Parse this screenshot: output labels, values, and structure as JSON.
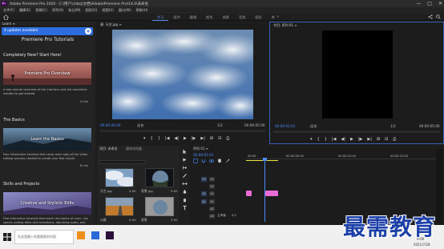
{
  "window": {
    "app_icon": "Pr",
    "title": "Adobe Premiere Pro 2020 - C:\\用户\\chbsj\\文档\\Adobe\\Premiere Pro\\14.0\\未命名",
    "controls": [
      "—",
      "□",
      "✕"
    ]
  },
  "menu": [
    "文件(F)",
    "编辑(E)",
    "剪辑(C)",
    "序列(S)",
    "标记(M)",
    "图形(G)",
    "视图(V)",
    "窗口(W)",
    "帮助(H)"
  ],
  "workspaces": {
    "tabs": [
      "学习",
      "组件",
      "编辑",
      "颜色",
      "效果",
      "音频",
      "图形",
      "库"
    ],
    "active_index": 0,
    "more": "»"
  },
  "learn": {
    "tab": "Learn ≡",
    "updates_banner": "4 updates available",
    "heading": "Premiere Pro Tutorials",
    "sections": [
      {
        "title": "Completely New? Start Here!",
        "card_title": "Premiere Pro Overview",
        "desc": "A two-minute overview of the interface and the essentials needed to get started.",
        "duration": "2 min"
      },
      {
        "title": "The Basics",
        "card_title": "Learn the Basics",
        "desc": "Four interactive tutorials that cover each step of the video editing process needed to create your first movie.",
        "duration": "8 min"
      },
      {
        "title": "Skills and Projects",
        "card_title": "Creative and Stylistic Edits",
        "desc": "Five interactive tutorials that teach the basics of color, clip speed, adding titles and transitions, adjusting audio, and color correction."
      }
    ]
  },
  "source_monitor": {
    "tab": "源: 天空.jpg ≡",
    "timecode_in": "00:00:00:00",
    "fit": "适合",
    "scale": "1/2",
    "timecode_dur": "00:00:05:00"
  },
  "program_monitor": {
    "tab": "节目: 序列 01 ≡",
    "timecode_in": "00:00:01:01",
    "fit": "适合",
    "scale": "1/2",
    "timecode_dur": "00:00:05:00"
  },
  "transport_glyphs": [
    "▾",
    "{",
    "}",
    "|◀",
    "◀|",
    "▶",
    "|▶",
    "▶|",
    "⊞",
    "⊟",
    "⎙"
  ],
  "project": {
    "tabs": [
      "项目: 未命名",
      "媒体浏览器"
    ],
    "search_placeholder": "",
    "items": [
      {
        "label": "天空.jpg",
        "duration": "5:00"
      },
      {
        "label": "背景.jpg",
        "duration": "5:00"
      },
      {
        "label": "公路",
        "duration": "5:00"
      },
      {
        "label": "背景",
        "duration": "5:00"
      }
    ],
    "footer_icons": [
      "list-icon",
      "icon-view-icon",
      "zoom-slider-icon",
      "new-bin-icon",
      "new-item-icon",
      "trash-icon"
    ]
  },
  "timeline": {
    "tab": "序列 01 ≡",
    "timecode": "00:00:01:01",
    "ruler": [
      "00:00",
      "00:00:05:00",
      "00:00:10:00",
      "00:00:15:00"
    ],
    "video_tracks": [
      "V3",
      "V2",
      "V1"
    ],
    "audio_tracks": [
      "A1",
      "A2",
      "A3"
    ],
    "master": "主声道",
    "master_value": "0.0"
  },
  "taskbar": {
    "search_placeholder": "在这里输入你要搜索的内容",
    "time": "9:00",
    "date": "2021/7/28"
  },
  "watermark": "最需教育",
  "colors": {
    "accent": "#2d6de0",
    "timecode": "#4a8bff",
    "clip_pink": "#e86bd7",
    "playhead": "#4a8bff",
    "workarea": "#f0e53c"
  }
}
